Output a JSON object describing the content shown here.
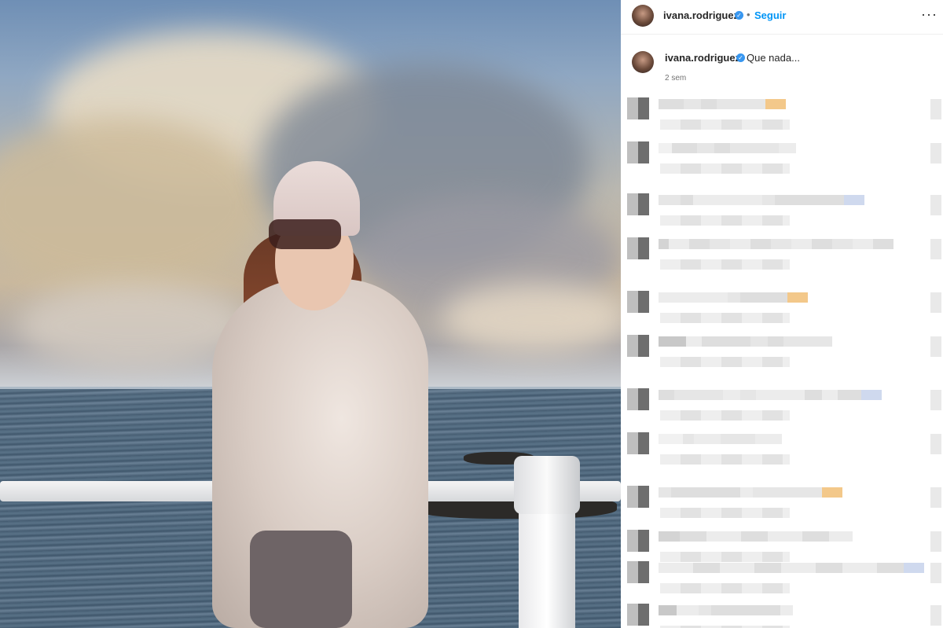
{
  "post": {
    "author": "ivana.rodriguez",
    "verified_mark": "✓",
    "separator": "•",
    "follow_label": "Seguir",
    "more_label": "···",
    "caption": {
      "author": "ivana.rodriguez",
      "text": "Que nada...",
      "time": "2 sem"
    }
  },
  "icons": [
    "avatar",
    "verified-badge-icon",
    "more-options-icon"
  ],
  "colors": {
    "accent": "#0095f6",
    "verified": "#3897f0",
    "text": "#262626",
    "muted": "#737373"
  },
  "comments_note_blurred": true
}
